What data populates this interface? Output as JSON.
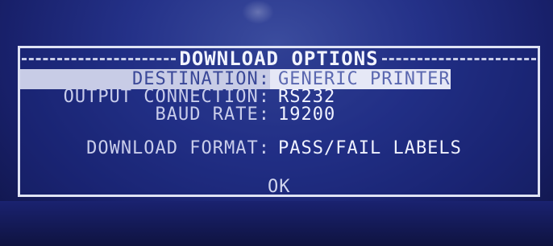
{
  "dialog": {
    "title": "DOWNLOAD OPTIONS",
    "fields": [
      {
        "label": "DESTINATION:",
        "value": "GENERIC PRINTER"
      },
      {
        "label": "OUTPUT CONNECTION:",
        "value": "RS232"
      },
      {
        "label": "BAUD RATE:",
        "value": "19200"
      },
      {
        "label": "DOWNLOAD FORMAT:",
        "value": "PASS/FAIL LABELS"
      }
    ],
    "ok_label": "OK"
  },
  "colors": {
    "screen_background": "#243188",
    "text": "#c9cdeb",
    "selected_background": "#e6e8f6"
  }
}
